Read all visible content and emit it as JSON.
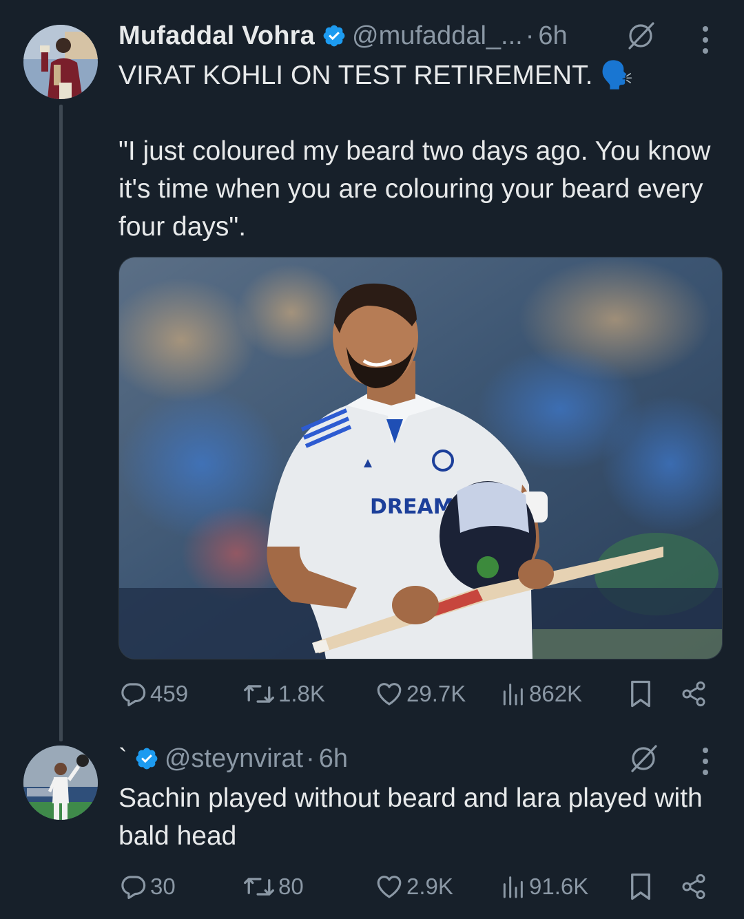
{
  "tweets": [
    {
      "author_name": "Mufaddal Vohra",
      "handle": "@mufaddal_...",
      "separator": "·",
      "time": "6h",
      "line1": "VIRAT KOHLI ON TEST RETIREMENT. 🗣️",
      "body": "\"I just coloured my beard two days ago. You know it's time when you are colouring your beard every four days\".",
      "image_logo_text": "DREAM",
      "stats": {
        "replies": "459",
        "retweets": "1.8K",
        "likes": "29.7K",
        "views": "862K"
      }
    },
    {
      "author_name": "`",
      "handle": "@steynvirat",
      "separator": "·",
      "time": "6h",
      "body": "Sachin played without beard and lara played with bald head",
      "stats": {
        "replies": "30",
        "retweets": "80",
        "likes": "2.9K",
        "views": "91.6K"
      }
    }
  ],
  "colors": {
    "background": "#17202a",
    "text_primary": "#e7e9ea",
    "text_secondary": "#8b98a5",
    "verified_blue": "#1d9bf0",
    "thread_line": "#3e4852"
  },
  "icons": {
    "verified": "verified-badge-icon",
    "grok": "grok-icon",
    "more": "more-options-icon",
    "reply": "reply-icon",
    "retweet": "retweet-icon",
    "like": "heart-icon",
    "views": "views-icon",
    "bookmark": "bookmark-icon",
    "share": "share-icon"
  }
}
